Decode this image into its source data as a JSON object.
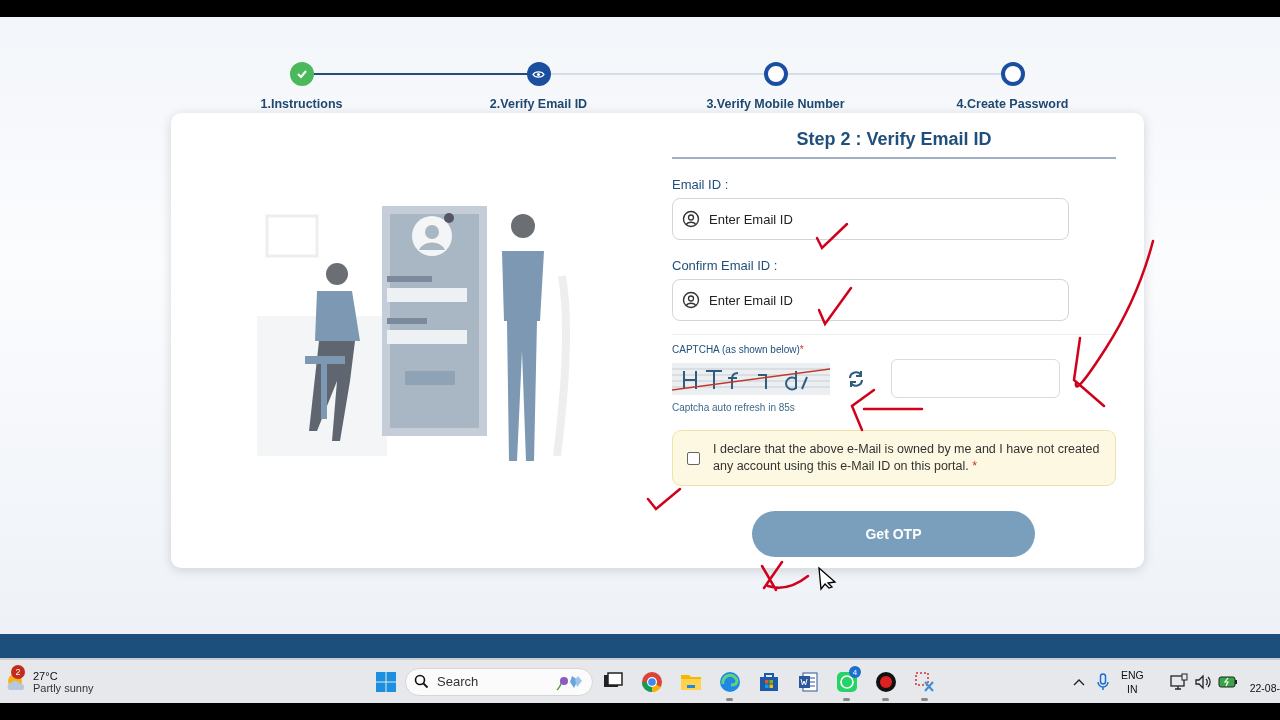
{
  "stepper": {
    "steps": [
      {
        "label": "1.Instructions",
        "kind": "done"
      },
      {
        "label": "2.Verify Email ID",
        "kind": "current"
      },
      {
        "label": "3.Verify Mobile Number",
        "kind": "pending"
      },
      {
        "label": "4.Create Password",
        "kind": "pending"
      }
    ]
  },
  "form": {
    "title": "Step 2 : Verify Email ID",
    "fields": [
      {
        "label": "Email ID :",
        "placeholder": "Enter Email ID"
      },
      {
        "label": "Confirm Email ID :",
        "placeholder": "Enter Email ID"
      }
    ],
    "captcha": {
      "label": "CAPTCHA (as shown below)",
      "required_mark": "*",
      "refresh_note": "Captcha auto refresh in 85s"
    },
    "declaration": {
      "text": "I declare that the above e-Mail is owned by me and I have not created any account using this e-Mail ID on this portal.",
      "required_mark": "*",
      "checked": false
    },
    "submit": {
      "label": "Get OTP",
      "disabled": true
    }
  },
  "taskbar": {
    "weather": {
      "badge": "2",
      "temperature": "27°C",
      "condition": "Partly sunny"
    },
    "search": {
      "placeholder": "Search"
    },
    "apps": [
      {
        "kind": "taskview",
        "running": false
      },
      {
        "kind": "chrome",
        "running": false
      },
      {
        "kind": "files",
        "running": false
      },
      {
        "kind": "edge",
        "running": true
      },
      {
        "kind": "store",
        "running": false
      },
      {
        "kind": "word",
        "running": false
      },
      {
        "kind": "whatsapp",
        "running": true,
        "badge": "4"
      },
      {
        "kind": "recorder",
        "running": true
      },
      {
        "kind": "snip",
        "running": true
      }
    ],
    "tray": {
      "language": "ENG",
      "region": "IN",
      "clock": "22-08-"
    }
  }
}
